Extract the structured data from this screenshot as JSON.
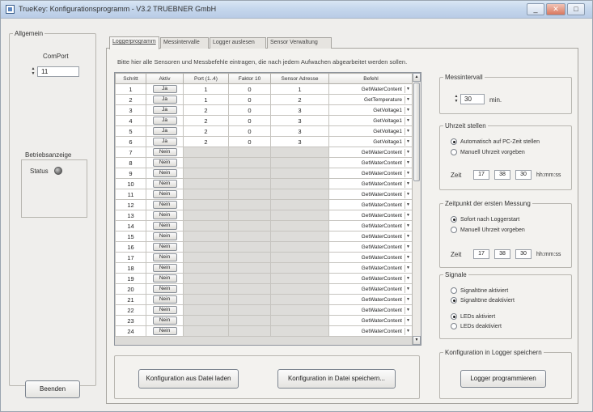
{
  "window": {
    "title": "TrueKey: Konfigurationsprogramm - V3.2    TRUEBNER GmbH",
    "minimize": "_",
    "maximize": "□",
    "close": "✕"
  },
  "left": {
    "group_label": "Allgemein",
    "comport_label": "ComPort",
    "comport_value": "11",
    "status_group_label": "Betriebsanzeige",
    "status_label": "Status",
    "exit_button": "Beenden"
  },
  "tabs": [
    "Loggerprogramm",
    "Messintervalle",
    "Logger auslesen",
    "Sensor Verwaltung"
  ],
  "description": "Bitte hier alle Sensoren und Messbefehle eintragen, die nach jedem Aufwachen abgearbeitet werden sollen.",
  "table": {
    "headers": [
      "Schritt",
      "Aktiv",
      "Port (1..4)",
      "Faktor 10",
      "Sensor Adresse",
      "Befehl"
    ],
    "rows": [
      {
        "step": "1",
        "active": "Ja",
        "port": "1",
        "factor": "0",
        "addr": "1",
        "cmd": "GetWaterContent"
      },
      {
        "step": "2",
        "active": "Ja",
        "port": "1",
        "factor": "0",
        "addr": "2",
        "cmd": "GetTemperature"
      },
      {
        "step": "3",
        "active": "Ja",
        "port": "2",
        "factor": "0",
        "addr": "3",
        "cmd": "GetVoltage1"
      },
      {
        "step": "4",
        "active": "Ja",
        "port": "2",
        "factor": "0",
        "addr": "3",
        "cmd": "GetVoltage1"
      },
      {
        "step": "5",
        "active": "Ja",
        "port": "2",
        "factor": "0",
        "addr": "3",
        "cmd": "GetVoltage1"
      },
      {
        "step": "6",
        "active": "Ja",
        "port": "2",
        "factor": "0",
        "addr": "3",
        "cmd": "GetVoltage1"
      },
      {
        "step": "7",
        "active": "Nein",
        "port": "",
        "factor": "",
        "addr": "",
        "cmd": "GetWaterContent"
      },
      {
        "step": "8",
        "active": "Nein",
        "port": "",
        "factor": "",
        "addr": "",
        "cmd": "GetWaterContent"
      },
      {
        "step": "9",
        "active": "Nein",
        "port": "",
        "factor": "",
        "addr": "",
        "cmd": "GetWaterContent"
      },
      {
        "step": "10",
        "active": "Nein",
        "port": "",
        "factor": "",
        "addr": "",
        "cmd": "GetWaterContent"
      },
      {
        "step": "11",
        "active": "Nein",
        "port": "",
        "factor": "",
        "addr": "",
        "cmd": "GetWaterContent"
      },
      {
        "step": "12",
        "active": "Nein",
        "port": "",
        "factor": "",
        "addr": "",
        "cmd": "GetWaterContent"
      },
      {
        "step": "13",
        "active": "Nein",
        "port": "",
        "factor": "",
        "addr": "",
        "cmd": "GetWaterContent"
      },
      {
        "step": "14",
        "active": "Nein",
        "port": "",
        "factor": "",
        "addr": "",
        "cmd": "GetWaterContent"
      },
      {
        "step": "15",
        "active": "Nein",
        "port": "",
        "factor": "",
        "addr": "",
        "cmd": "GetWaterContent"
      },
      {
        "step": "16",
        "active": "Nein",
        "port": "",
        "factor": "",
        "addr": "",
        "cmd": "GetWaterContent"
      },
      {
        "step": "17",
        "active": "Nein",
        "port": "",
        "factor": "",
        "addr": "",
        "cmd": "GetWaterContent"
      },
      {
        "step": "18",
        "active": "Nein",
        "port": "",
        "factor": "",
        "addr": "",
        "cmd": "GetWaterContent"
      },
      {
        "step": "19",
        "active": "Nein",
        "port": "",
        "factor": "",
        "addr": "",
        "cmd": "GetWaterContent"
      },
      {
        "step": "20",
        "active": "Nein",
        "port": "",
        "factor": "",
        "addr": "",
        "cmd": "GetWaterContent"
      },
      {
        "step": "21",
        "active": "Nein",
        "port": "",
        "factor": "",
        "addr": "",
        "cmd": "GetWaterContent"
      },
      {
        "step": "22",
        "active": "Nein",
        "port": "",
        "factor": "",
        "addr": "",
        "cmd": "GetWaterContent"
      },
      {
        "step": "23",
        "active": "Nein",
        "port": "",
        "factor": "",
        "addr": "",
        "cmd": "GetWaterContent"
      },
      {
        "step": "24",
        "active": "Nein",
        "port": "",
        "factor": "",
        "addr": "",
        "cmd": "GetWaterContent"
      }
    ]
  },
  "bottom_buttons": {
    "load": "Konfiguration aus Datei laden",
    "save": "Konfiguration in Datei speichern..."
  },
  "right": {
    "interval": {
      "label": "Messintervall",
      "value": "30",
      "unit": "min."
    },
    "clock": {
      "label": "Uhrzeit stellen",
      "opt_auto": "Automatisch auf PC-Zeit stellen",
      "opt_manual": "Manuell Uhrzeit vorgeben",
      "time_label": "Zeit",
      "h": "17",
      "m": "38",
      "s": "30",
      "time_format": "hh:mm:ss"
    },
    "first_measure": {
      "label": "Zeitpunkt der ersten Messung",
      "opt_now": "Sofort nach Loggerstart",
      "opt_manual": "Manuell Uhrzeit vorgeben",
      "time_label": "Zeit",
      "h": "17",
      "m": "38",
      "s": "30",
      "time_format": "hh:mm:ss"
    },
    "signals": {
      "label": "Signale",
      "opt1": "Signaltöne aktiviert",
      "opt2": "Signaltöne deaktiviert",
      "opt3": "LEDs aktiviert",
      "opt4": "LEDs deaktiviert"
    },
    "program": {
      "label": "Konfiguration in Logger speichern",
      "button": "Logger programmieren"
    }
  }
}
